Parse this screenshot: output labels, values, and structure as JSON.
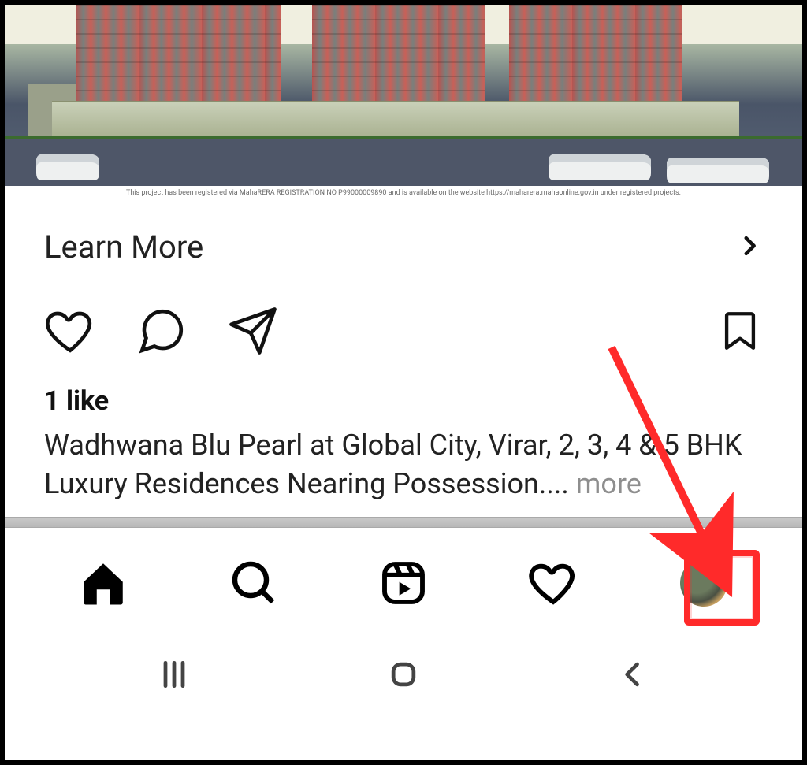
{
  "post": {
    "disclaimer": "This project has been registered via MahaRERA REGISTRATION NO P99000009890 and is available on the website https://maharera.mahaonline.gov.in under registered projects.",
    "cta_label": "Learn More",
    "likes_text": "1 like",
    "caption_text": "Wadhwana Blu Pearl at Global City, Virar, 2, 3, 4 & 5 BHK Luxury Residences Nearing Possession.... ",
    "more_label": "more"
  },
  "tabs": {
    "home": "Home",
    "search": "Search",
    "reels": "Reels",
    "activity": "Activity",
    "profile": "Profile"
  },
  "sysnav": {
    "recents": "Recents",
    "home": "Home",
    "back": "Back"
  },
  "annotation": {
    "target": "profile-tab"
  }
}
